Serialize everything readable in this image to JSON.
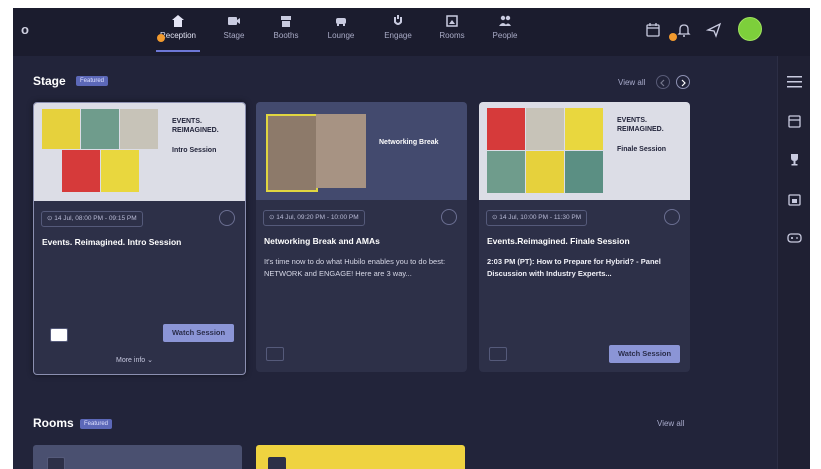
{
  "topbar": {
    "logo": "o",
    "nav": [
      {
        "label": "Reception",
        "icon": "home-icon"
      },
      {
        "label": "Stage",
        "icon": "video-icon"
      },
      {
        "label": "Booths",
        "icon": "booth-icon"
      },
      {
        "label": "Lounge",
        "icon": "lounge-icon"
      },
      {
        "label": "Engage",
        "icon": "engage-icon"
      },
      {
        "label": "Rooms",
        "icon": "rooms-icon"
      },
      {
        "label": "People",
        "icon": "people-icon"
      }
    ]
  },
  "stage": {
    "title": "Stage",
    "badge": "Featured",
    "view_all": "View all",
    "cards": [
      {
        "thumb_line1": "EVENTS.",
        "thumb_line2": "REIMAGINED.",
        "thumb_session": "Intro Session",
        "time": "14 Jul, 08:00 PM - 09:15 PM",
        "title": "Events. Reimagined. Intro Session",
        "desc": "",
        "button": "Watch Session",
        "more": "More info"
      },
      {
        "thumb_text": "Networking Break",
        "time": "14 Jul, 09:20 PM - 10:00 PM",
        "title": "Networking Break and AMAs",
        "desc": "It's time now to do what Hubilo enables you to do best: NETWORK and ENGAGE! Here are 3 way..."
      },
      {
        "thumb_line1": "EVENTS.",
        "thumb_line2": "REIMAGINED.",
        "thumb_session": "Finale Session",
        "time": "14 Jul, 10:00 PM - 11:30 PM",
        "title": "Events.Reimagined. Finale Session",
        "desc": "2:03 PM (PT): How to Prepare for Hybrid? - Panel Discussion with Industry Experts...",
        "button": "Watch Session"
      }
    ]
  },
  "rooms": {
    "title": "Rooms",
    "badge": "Featured",
    "view_all": "View all"
  },
  "colors": {
    "background": "#22243a",
    "accent": "#8b95d6",
    "avatar": "#7dcf3b",
    "notification": "#f29a2e"
  }
}
